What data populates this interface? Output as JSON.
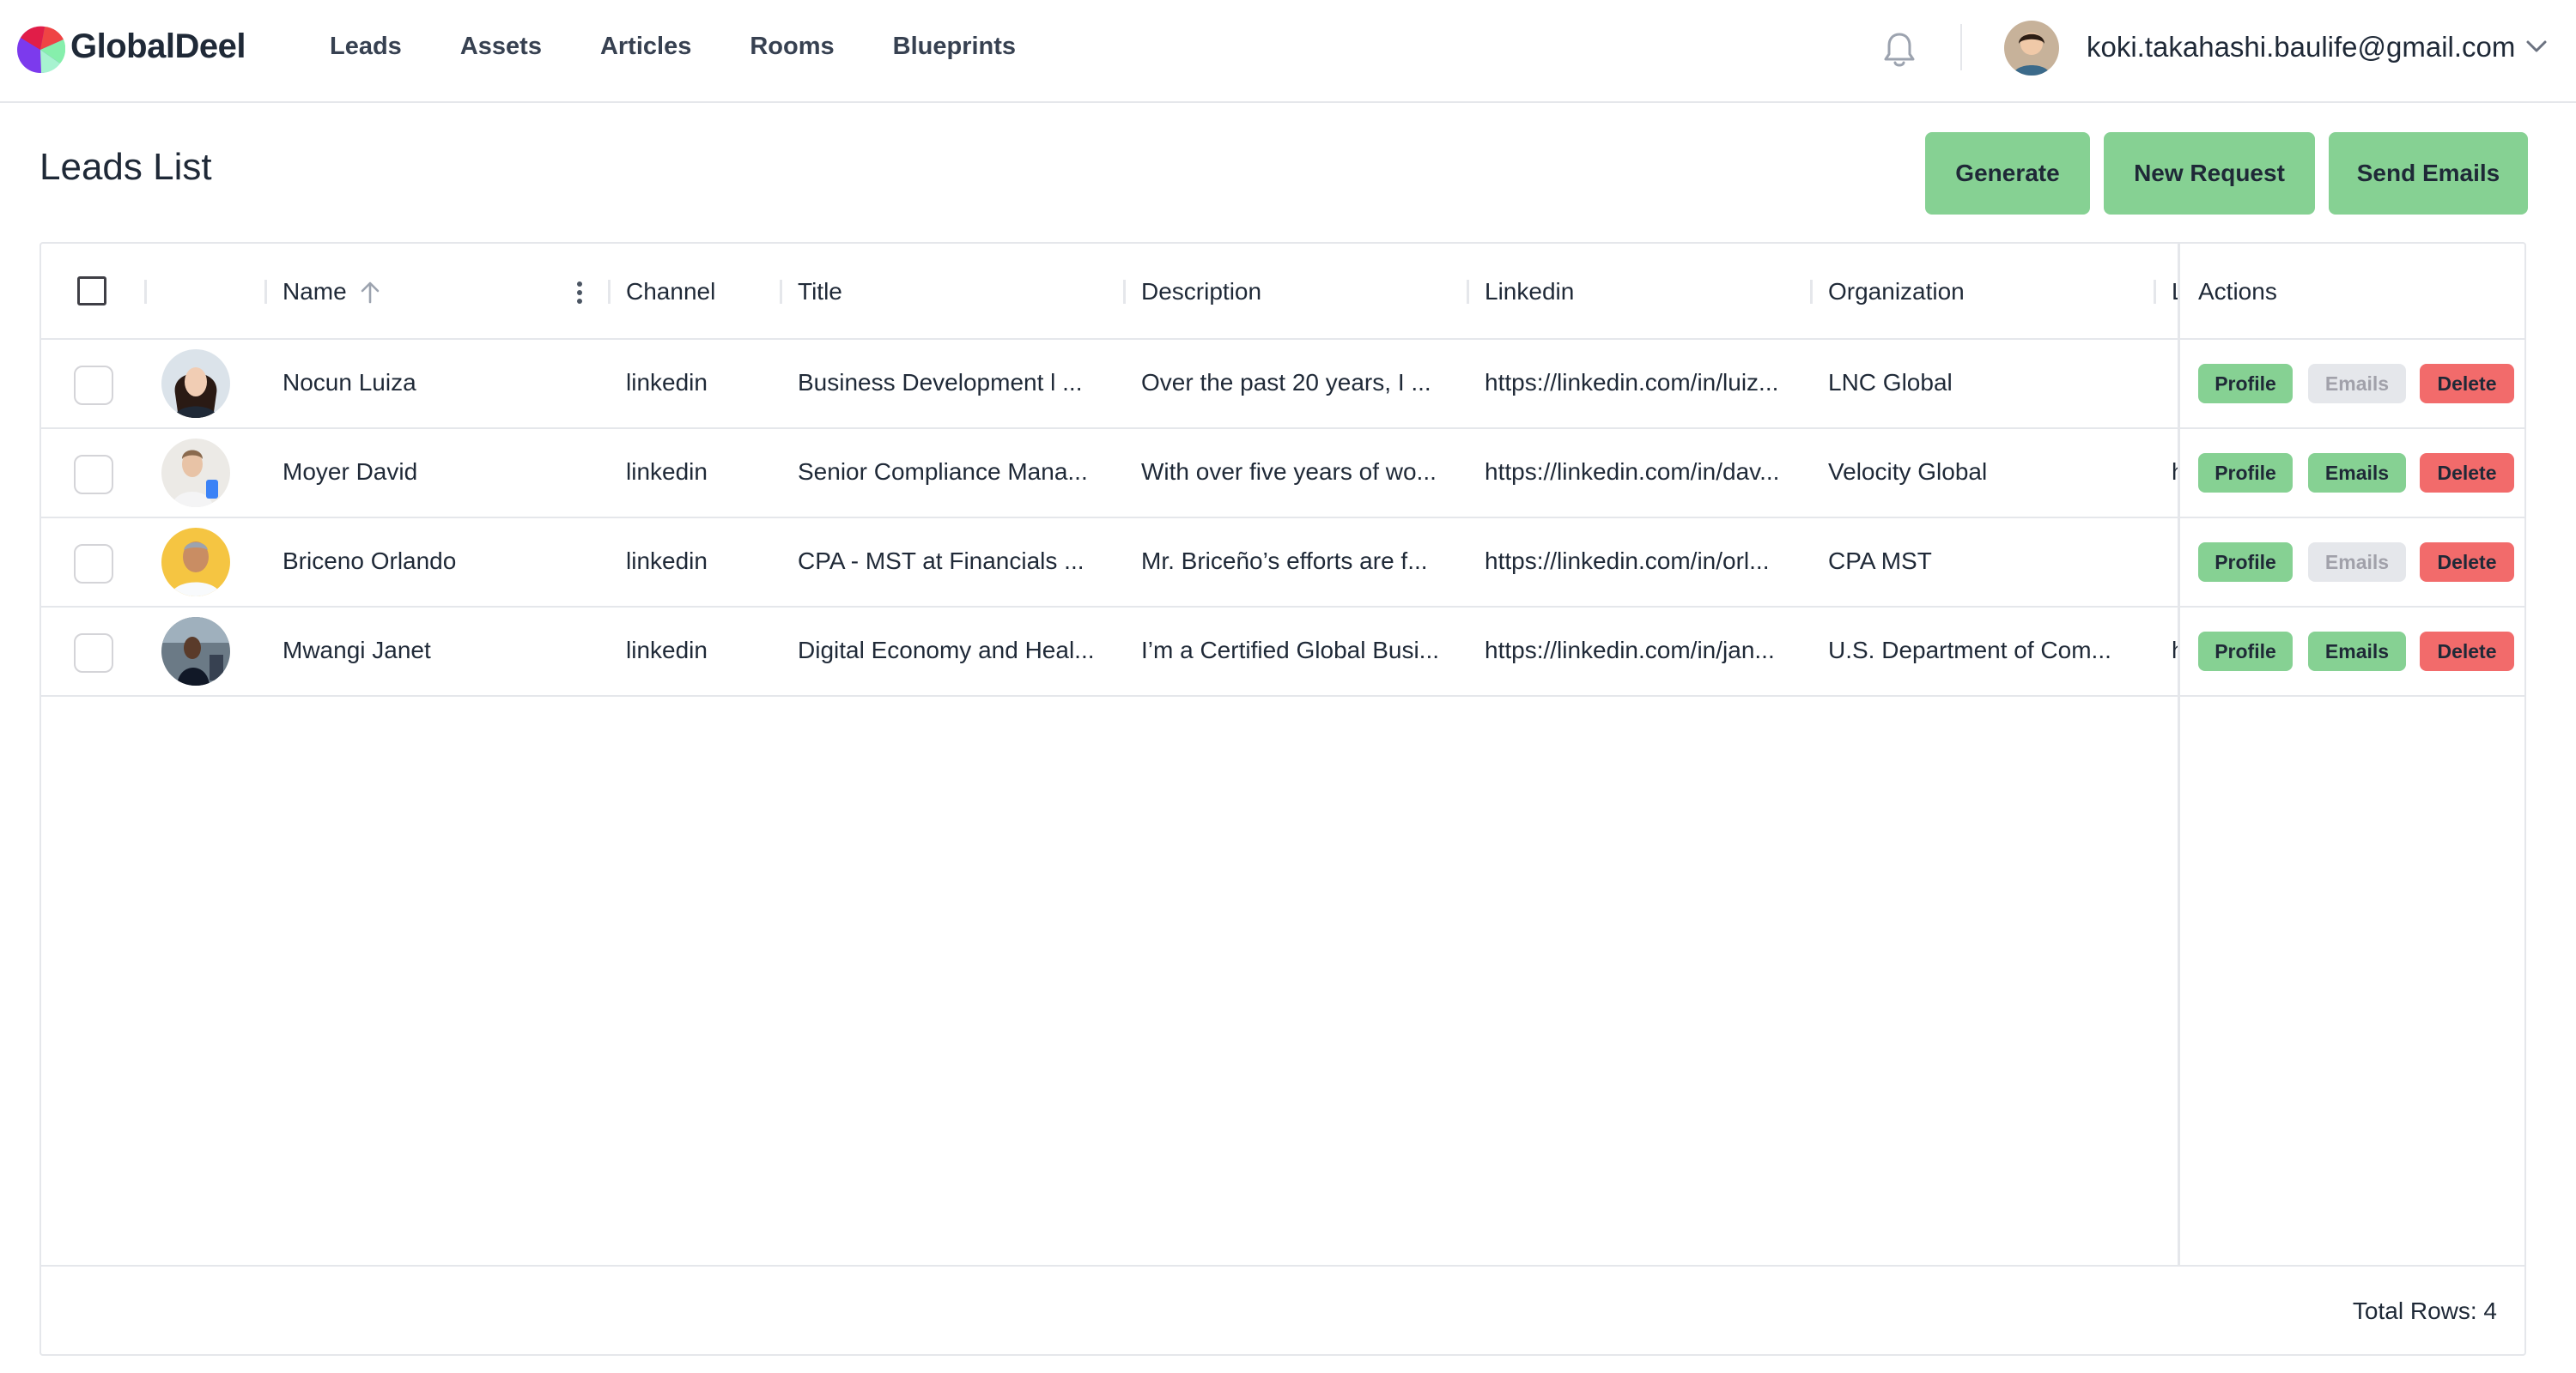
{
  "app": {
    "brand": "GlobalDeel",
    "nav": [
      "Leads",
      "Assets",
      "Articles",
      "Rooms",
      "Blueprints"
    ],
    "user_email": "koki.takahashi.baulife@gmail.com",
    "icons": {
      "notifications": "bell-icon",
      "user_menu": "chevron-down-icon",
      "sort": "arrow-up-icon",
      "column_menu": "kebab-menu-icon"
    }
  },
  "page": {
    "title": "Leads List",
    "buttons": {
      "generate": "Generate",
      "new_request": "New Request",
      "send_emails": "Send Emails"
    }
  },
  "table": {
    "columns": {
      "name": "Name",
      "channel": "Channel",
      "title": "Title",
      "description": "Description",
      "linkedin": "Linkedin",
      "organization": "Organization",
      "next": "L",
      "actions": "Actions"
    },
    "rows": [
      {
        "name": "Nocun Luiza",
        "channel": "linkedin",
        "title": "Business Development l ...",
        "description": "Over the past 20 years, I ...",
        "linkedin": "https://linkedin.com/in/luiz...",
        "organization": "LNC Global",
        "next": "",
        "actions": {
          "profile": "Profile",
          "emails": "Emails",
          "emails_enabled": false,
          "delete": "Delete"
        }
      },
      {
        "name": "Moyer David",
        "channel": "linkedin",
        "title": "Senior Compliance Mana...",
        "description": "With over five years of wo...",
        "linkedin": "https://linkedin.com/in/dav...",
        "organization": "Velocity Global",
        "next": "h",
        "actions": {
          "profile": "Profile",
          "emails": "Emails",
          "emails_enabled": true,
          "delete": "Delete"
        }
      },
      {
        "name": "Briceno Orlando",
        "channel": "linkedin",
        "title": "CPA - MST at Financials ...",
        "description": "Mr. Briceño’s efforts are f...",
        "linkedin": "https://linkedin.com/in/orl...",
        "organization": "CPA MST",
        "next": "",
        "actions": {
          "profile": "Profile",
          "emails": "Emails",
          "emails_enabled": false,
          "delete": "Delete"
        }
      },
      {
        "name": "Mwangi Janet",
        "channel": "linkedin",
        "title": "Digital Economy and Heal...",
        "description": "I’m a Certified Global Busi...",
        "linkedin": "https://linkedin.com/in/jan...",
        "organization": "U.S. Department of Com...",
        "next": "h",
        "actions": {
          "profile": "Profile",
          "emails": "Emails",
          "emails_enabled": true,
          "delete": "Delete"
        }
      }
    ],
    "footer": "Total Rows: 4"
  },
  "colors": {
    "accent_green": "#86d193",
    "delete_red": "#f26b6b",
    "disabled_gray": "#e5e7eb",
    "border": "#e5e7eb"
  }
}
